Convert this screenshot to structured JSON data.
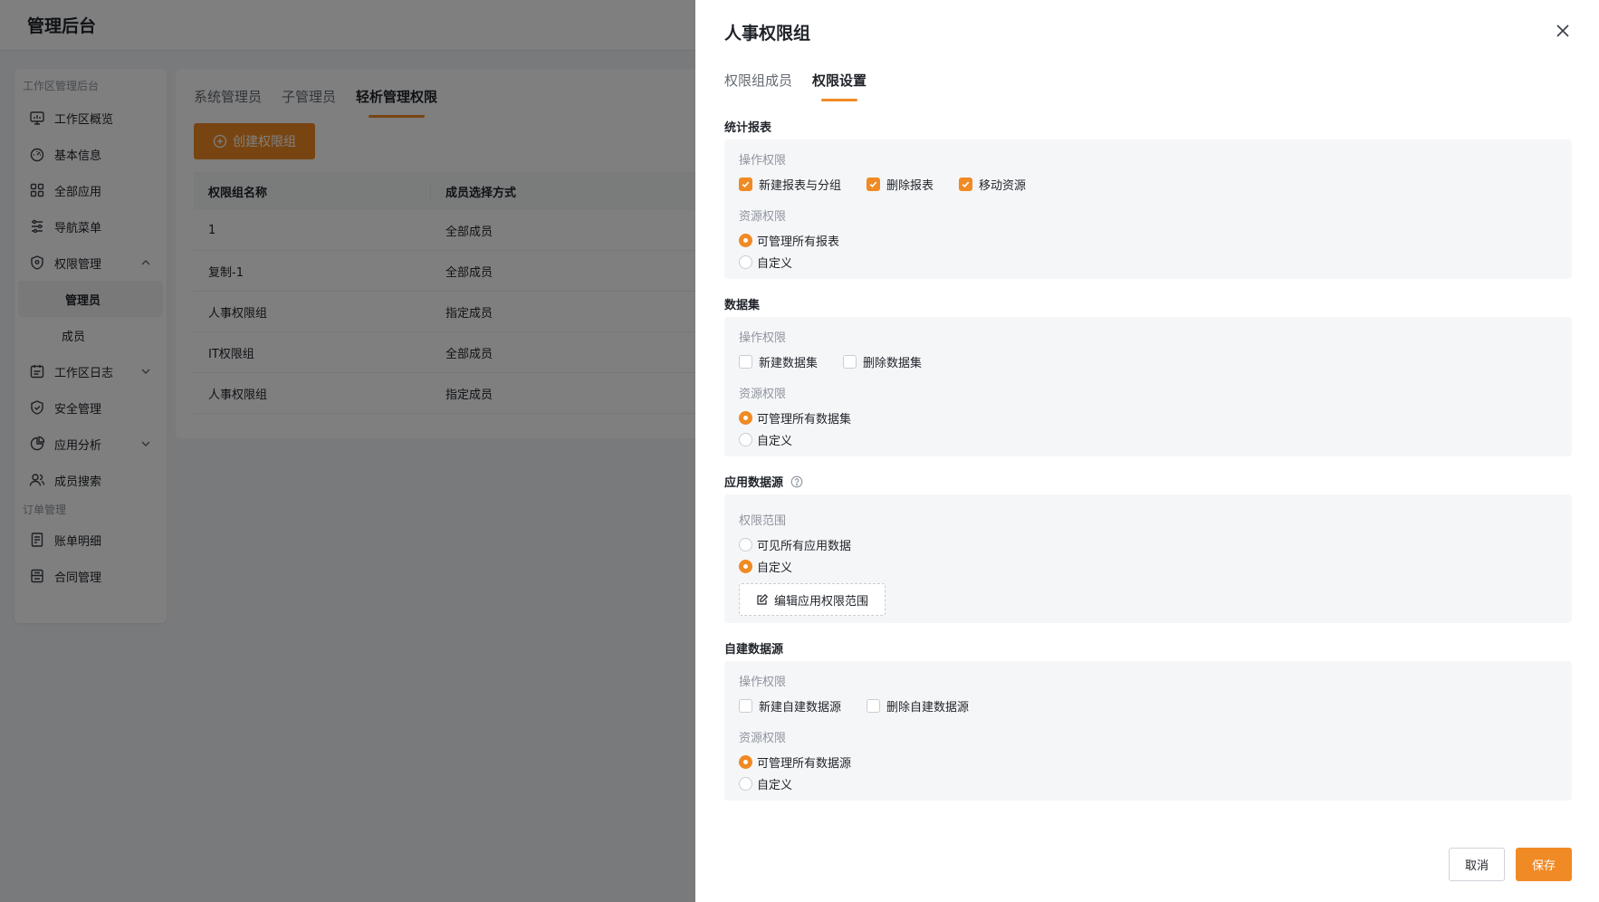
{
  "app": {
    "title": "管理后台"
  },
  "sidebar": {
    "group1": "工作区管理后台",
    "items": [
      {
        "label": "工作区概览",
        "icon": "monitor-icon"
      },
      {
        "label": "基本信息",
        "icon": "dashboard-icon"
      },
      {
        "label": "全部应用",
        "icon": "grid-icon"
      },
      {
        "label": "导航菜单",
        "icon": "sliders-icon"
      },
      {
        "label": "权限管理",
        "icon": "shield-icon"
      },
      {
        "label": "工作区日志",
        "icon": "calendar-icon"
      },
      {
        "label": "安全管理",
        "icon": "shield-check-icon"
      },
      {
        "label": "应用分析",
        "icon": "pie-chart-icon"
      },
      {
        "label": "成员搜索",
        "icon": "users-icon"
      }
    ],
    "sub_items": [
      "管理员",
      "成员"
    ],
    "group2": "订单管理",
    "items2": [
      {
        "label": "账单明细",
        "icon": "receipt-icon"
      },
      {
        "label": "合同管理",
        "icon": "contract-icon"
      }
    ]
  },
  "content": {
    "tabs": [
      "系统管理员",
      "子管理员",
      "轻析管理权限"
    ],
    "create_button": "创建权限组",
    "table": {
      "headers": [
        "权限组名称",
        "成员选择方式"
      ],
      "rows": [
        [
          "1",
          "全部成员"
        ],
        [
          "复制-1",
          "全部成员"
        ],
        [
          "人事权限组",
          "指定成员"
        ],
        [
          "IT权限组",
          "全部成员"
        ],
        [
          "人事权限组",
          "指定成员"
        ]
      ]
    }
  },
  "drawer": {
    "title": "人事权限组",
    "tabs": [
      "权限组成员",
      "权限设置"
    ],
    "sections": {
      "reports": {
        "title": "统计报表",
        "op_label": "操作权限",
        "ops": [
          {
            "label": "新建报表与分组",
            "checked": true
          },
          {
            "label": "删除报表",
            "checked": true
          },
          {
            "label": "移动资源",
            "checked": true
          }
        ],
        "res_label": "资源权限",
        "res": [
          {
            "label": "可管理所有报表",
            "selected": true
          },
          {
            "label": "自定义",
            "selected": false
          }
        ]
      },
      "datasets": {
        "title": "数据集",
        "op_label": "操作权限",
        "ops": [
          {
            "label": "新建数据集",
            "checked": false
          },
          {
            "label": "删除数据集",
            "checked": false
          }
        ],
        "res_label": "资源权限",
        "res": [
          {
            "label": "可管理所有数据集",
            "selected": true
          },
          {
            "label": "自定义",
            "selected": false
          }
        ]
      },
      "app_sources": {
        "title": "应用数据源",
        "scope_label": "权限范围",
        "scope": [
          {
            "label": "可见所有应用数据",
            "selected": false
          },
          {
            "label": "自定义",
            "selected": true
          }
        ],
        "edit_button": "编辑应用权限范围"
      },
      "custom_sources": {
        "title": "自建数据源",
        "op_label": "操作权限",
        "ops": [
          {
            "label": "新建自建数据源",
            "checked": false
          },
          {
            "label": "删除自建数据源",
            "checked": false
          }
        ],
        "res_label": "资源权限",
        "res": [
          {
            "label": "可管理所有数据源",
            "selected": true
          },
          {
            "label": "自定义",
            "selected": false
          }
        ]
      }
    },
    "cancel": "取消",
    "save": "保存"
  },
  "colors": {
    "accent": "#f08a24",
    "panel_bg": "#f5f6f8",
    "overlay": "rgba(0,0,0,0.5)"
  }
}
